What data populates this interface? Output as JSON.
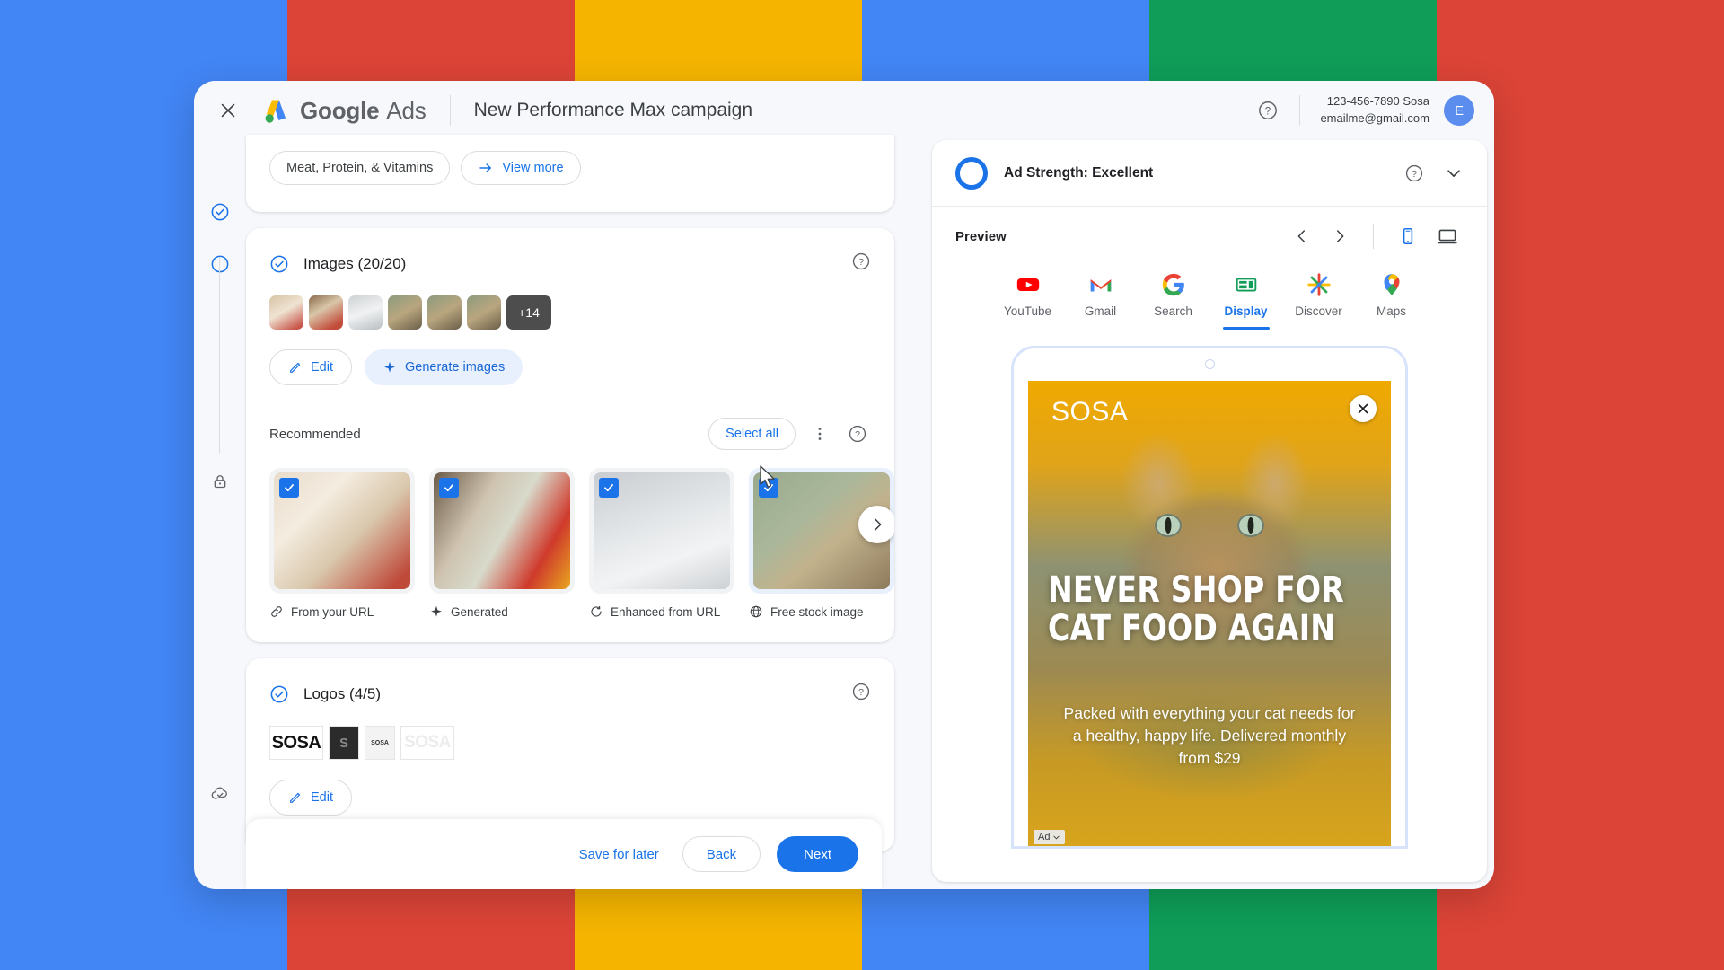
{
  "backdrop": {
    "colors": [
      "#4285f4",
      "#db4437",
      "#f4b400",
      "#4285f4",
      "#0f9d58",
      "#db4437"
    ]
  },
  "header": {
    "close_icon": "close-icon",
    "brand_google": "Google",
    "brand_ads": "Ads",
    "title": "New Performance Max campaign",
    "help_icon": "help-circle-icon",
    "account_name": "123-456-7890 Sosa",
    "account_email": "emailme@gmail.com",
    "avatar_initial": "E"
  },
  "rail": {
    "items": [
      {
        "name": "step-complete-icon"
      },
      {
        "name": "step-current-icon"
      },
      {
        "name": "lock-icon"
      },
      {
        "name": "cloud-done-icon"
      }
    ]
  },
  "top_card": {
    "chip_label": "Meat, Protein, & Vitamins",
    "view_more_label": "View more"
  },
  "images_section": {
    "title": "Images (20/20)",
    "help_icon": "help-circle-icon",
    "thumb_overflow": "+14",
    "edit_label": "Edit",
    "generate_label": "Generate images",
    "recommended": {
      "title": "Recommended",
      "select_all_label": "Select all",
      "more_icon": "more-vert-icon",
      "help_icon": "help-circle-icon",
      "next_icon": "chevron-right-icon",
      "cards": [
        {
          "label": "From your URL",
          "icon": "link-icon",
          "checked": true
        },
        {
          "label": "Generated",
          "icon": "sparkle-icon",
          "checked": true
        },
        {
          "label": "Enhanced from URL",
          "icon": "auto-enhance-icon",
          "checked": true
        },
        {
          "label": "Free stock image",
          "icon": "globe-icon",
          "checked": true
        }
      ]
    }
  },
  "logos_section": {
    "title": "Logos (4/5)",
    "help_icon": "help-circle-icon",
    "logos": [
      "SOSA",
      "S",
      "SOSA",
      "SOSA"
    ],
    "edit_label": "Edit"
  },
  "footer": {
    "save_for_later_label": "Save for later",
    "back_label": "Back",
    "next_label": "Next"
  },
  "preview_panel": {
    "ad_strength_label": "Ad Strength: Excellent",
    "help_icon": "help-circle-icon",
    "collapse_icon": "chevron-down-icon",
    "preview_label": "Preview",
    "prev_icon": "chevron-left-icon",
    "next_icon": "chevron-right-icon",
    "mobile_icon": "mobile-icon",
    "desktop_icon": "desktop-icon",
    "active_device": "mobile",
    "platforms": [
      {
        "label": "YouTube",
        "icon": "youtube-icon",
        "active": false
      },
      {
        "label": "Gmail",
        "icon": "gmail-icon",
        "active": false
      },
      {
        "label": "Search",
        "icon": "google-g-icon",
        "active": false
      },
      {
        "label": "Display",
        "icon": "display-icon",
        "active": true
      },
      {
        "label": "Discover",
        "icon": "discover-icon",
        "active": false
      },
      {
        "label": "Maps",
        "icon": "maps-pin-icon",
        "active": false
      }
    ],
    "ad": {
      "brand": "SOSA",
      "close_icon": "close-icon",
      "headline_line1": "NEVER SHOP FOR",
      "headline_line2": "CAT FOOD AGAIN",
      "description": "Packed with everything your cat needs for a healthy, happy life. Delivered monthly from $29",
      "ad_badge": "Ad"
    }
  },
  "colors": {
    "accent_blue": "#1a73e8",
    "tonal_blue": "#e8f0fe",
    "text_primary": "#202124",
    "text_secondary": "#5f6368"
  }
}
